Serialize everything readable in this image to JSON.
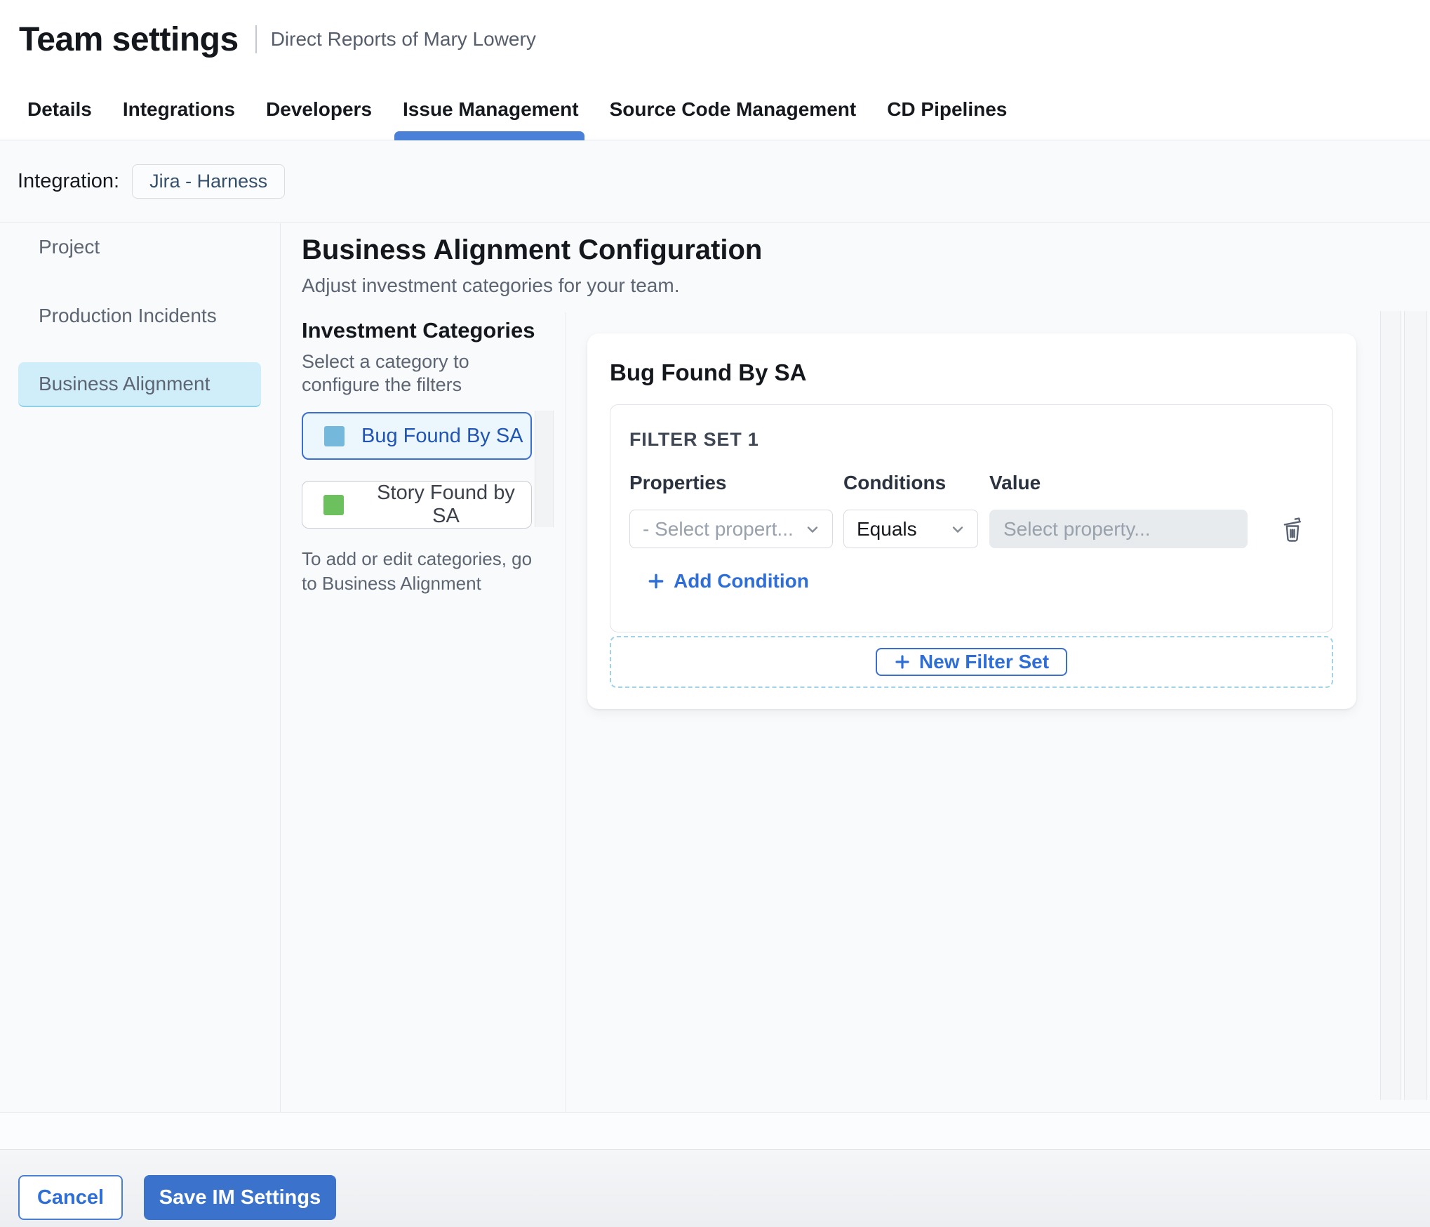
{
  "header": {
    "title": "Team settings",
    "subtitle": "Direct Reports of Mary Lowery"
  },
  "tabs": [
    {
      "label": "Details",
      "active": false
    },
    {
      "label": "Integrations",
      "active": false
    },
    {
      "label": "Developers",
      "active": false
    },
    {
      "label": "Issue Management",
      "active": true
    },
    {
      "label": "Source Code Management",
      "active": false
    },
    {
      "label": "CD Pipelines",
      "active": false
    }
  ],
  "integration_bar": {
    "label": "Integration:",
    "badge": "Jira - Harness"
  },
  "sidebar": {
    "items": [
      {
        "label": "Project",
        "selected": false
      },
      {
        "label": "Production Incidents",
        "selected": false
      },
      {
        "label": "Business Alignment",
        "selected": true
      }
    ]
  },
  "main": {
    "title": "Business Alignment Configuration",
    "subtitle": "Adjust investment categories for your team.",
    "categories": {
      "heading": "Investment Categories",
      "description": "Select a category to configure the filters",
      "items": [
        {
          "label": "Bug Found By SA",
          "swatch_color": "#74b9dc",
          "selected": true
        },
        {
          "label": "Story Found by SA",
          "swatch_color": "#6cc05e",
          "selected": false
        }
      ],
      "note": "To add or edit categories, go to Business Alignment"
    },
    "filter_panel": {
      "title": "Bug Found By SA",
      "filter_set": {
        "heading": "FILTER SET 1",
        "columns": {
          "properties": "Properties",
          "conditions": "Conditions",
          "value": "Value"
        },
        "property_select_value": "- Select propert...",
        "condition_select_value": "Equals",
        "value_placeholder": "Select property...",
        "add_condition_label": "Add Condition"
      },
      "new_filter_set_label": "New Filter Set"
    }
  },
  "footer": {
    "cancel_label": "Cancel",
    "save_label": "Save IM Settings"
  },
  "icons": {
    "plus": "+",
    "chevron_down": "v",
    "trash": "trash-can",
    "category_swatch": "square"
  },
  "colors": {
    "accent_blue": "#3b72cc",
    "link_blue": "#2e6ed6",
    "tab_underline": "#4a80d8",
    "selected_category_bg": "#ecf6fd",
    "selected_category_border": "#3a6fd0",
    "selected_category_text": "#2055b4",
    "sidebar_selected_bg": "#cfeef9",
    "swatch_blue": "#74b9dc",
    "swatch_green": "#6cc05e",
    "content_bg": "#f8fafc"
  }
}
